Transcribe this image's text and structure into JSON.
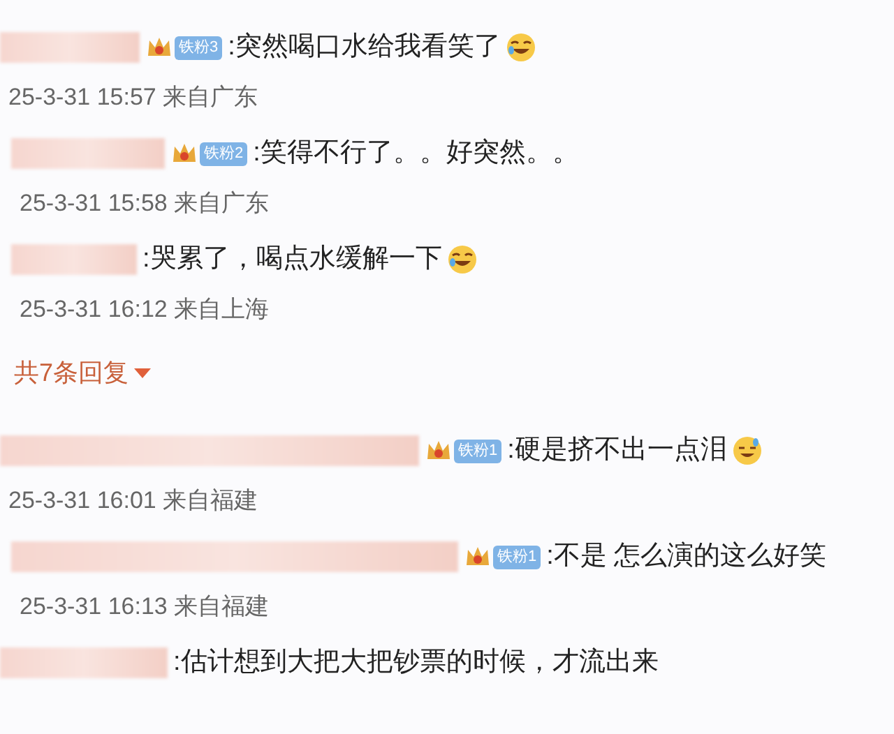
{
  "comments": [
    {
      "badge": "铁粉3",
      "text": ":突然喝口水给我看笑了",
      "emoji": {
        "kind": "laugh"
      },
      "time": "25-3-31 15:57 来自广东"
    },
    {
      "badge": "铁粉2",
      "text": ":笑得不行了。。好突然。。",
      "time": "25-3-31 15:58 来自广东"
    },
    {
      "text": ":哭累了，喝点水缓解一下",
      "emoji": {
        "kind": "laugh"
      },
      "time": "25-3-31 16:12 来自上海"
    },
    {
      "kind": "more",
      "text": "共7条回复"
    },
    {
      "badge": "铁粉1",
      "text": ":硬是挤不出一点泪",
      "emoji": {
        "kind": "sweat"
      },
      "time": "25-3-31 16:01 来自福建"
    },
    {
      "badge": "铁粉1",
      "text": ":不是 怎么演的这么好笑",
      "time": "25-3-31 16:13 来自福建"
    },
    {
      "text": ":估计想到大把大把钞票的时候，才流出来"
    }
  ]
}
